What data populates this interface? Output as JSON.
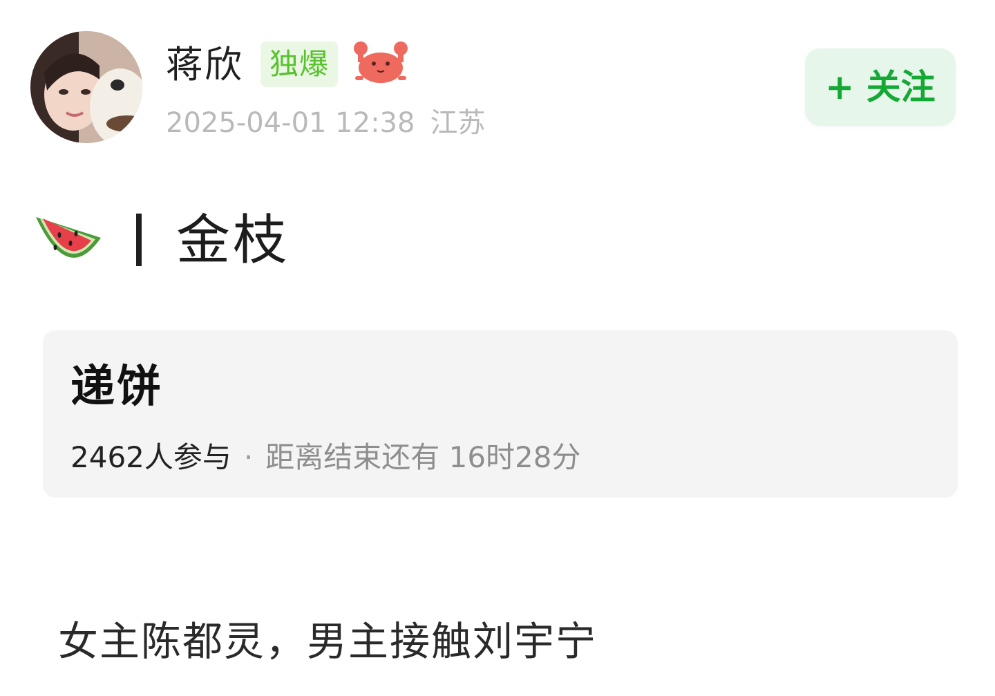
{
  "post": {
    "username": "蒋欣",
    "badge": "独爆",
    "timestamp": "2025-04-01 12:38",
    "location": "江苏",
    "follow_label": "+ 关注",
    "avatar_icon": "user-avatar",
    "crab_icon": "crab-emoji-icon",
    "topic_icon": "watermelon-emoji-icon",
    "topic": "金枝",
    "vote": {
      "title": "递饼",
      "participants": "2462人参与",
      "separator": "·",
      "remaining": "距离结束还有 16时28分"
    },
    "body": "女主陈都灵，男主接触刘宇宁"
  },
  "colors": {
    "follow_text": "#14a834",
    "follow_bg": "#e6f6ea",
    "badge_text": "#57c22d",
    "badge_bg": "#eaf7e4",
    "meta_text": "#b9b9b9"
  }
}
